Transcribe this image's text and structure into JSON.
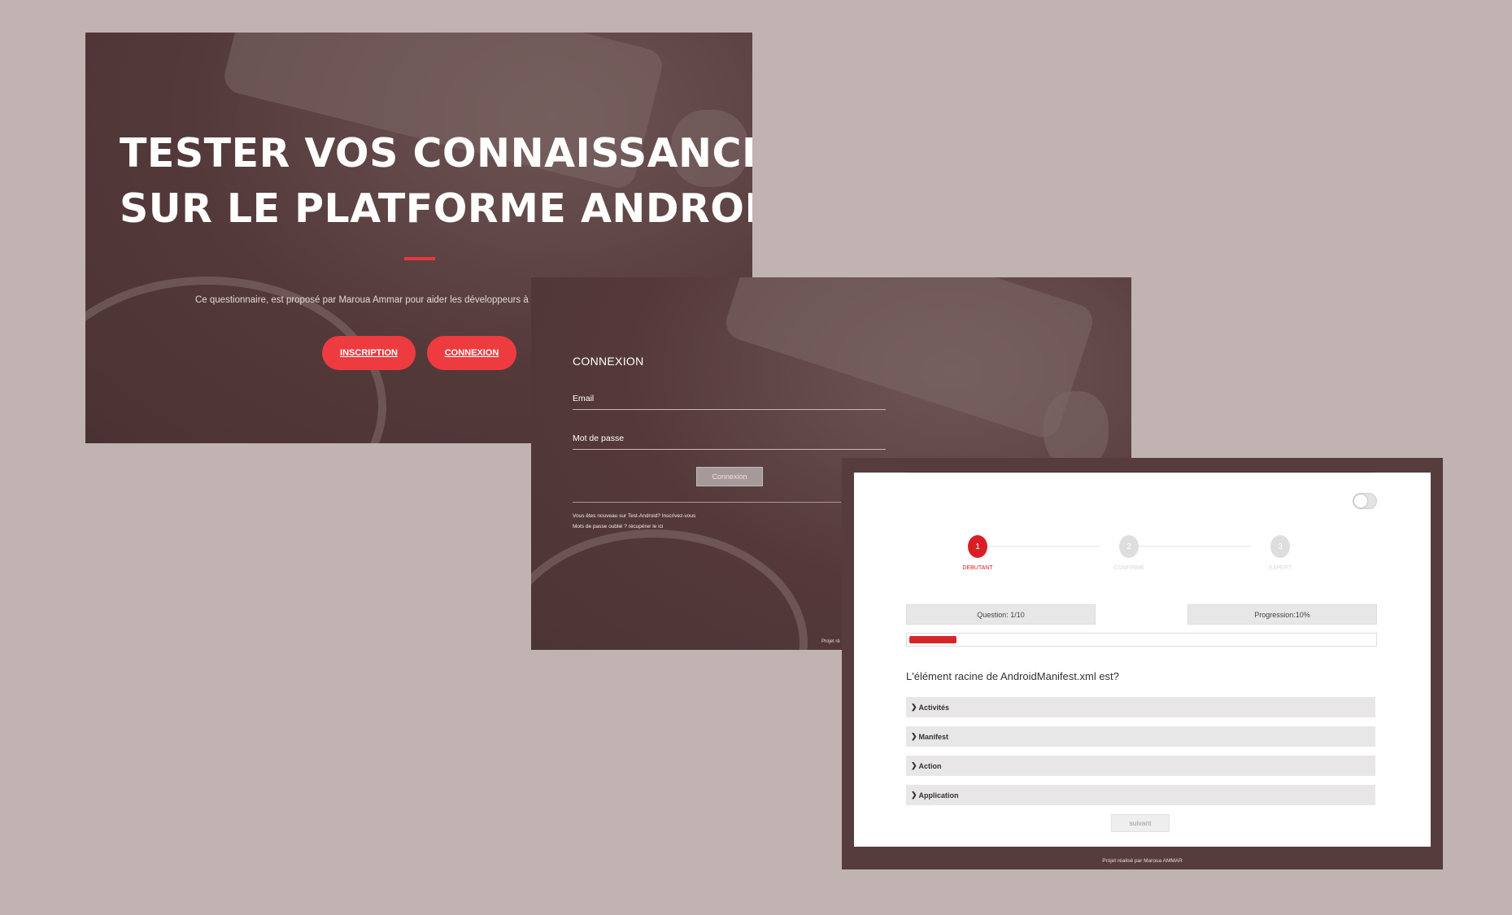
{
  "hero": {
    "title_line1": "TESTER VOS CONNAISSANCES",
    "title_line2": "SUR LE PLATFORME ANDROID",
    "description": "Ce questionnaire, est proposé par Maroua Ammar pour aider les développeurs à auto",
    "signup_label": "INSCRIPTION",
    "login_label": "CONNEXION"
  },
  "login": {
    "title": "CONNEXION",
    "email_label": "Email",
    "password_label": "Mot de passe",
    "submit_label": "Connexion",
    "signup_text": "Vous êtes nouveau sur Test-Android? Inscrivez-vous",
    "forgot_text": "Mots de passe oublié ? récupérer le ici",
    "footer": "Projet ré"
  },
  "quiz": {
    "steps": [
      {
        "number": "1",
        "label": "DEBUTANT",
        "active": true
      },
      {
        "number": "2",
        "label": "CONFIRME",
        "active": false
      },
      {
        "number": "3",
        "label": "EXPERT",
        "active": false
      }
    ],
    "question_counter": "Question: 1/10",
    "progression": "Progression:10%",
    "progress_fraction": 0.1,
    "question": "L'élément racine de AndroidManifest.xml est?",
    "answers": [
      "Activités",
      "Manifest",
      "Action",
      "Application"
    ],
    "next_label": "suivant",
    "footer": "Projet réalisé par Maroua AMMAR"
  },
  "colors": {
    "accent": "#ee3b3f",
    "progress": "#d7262b",
    "background": "#c0b3b2",
    "overlay": "#54393a"
  }
}
